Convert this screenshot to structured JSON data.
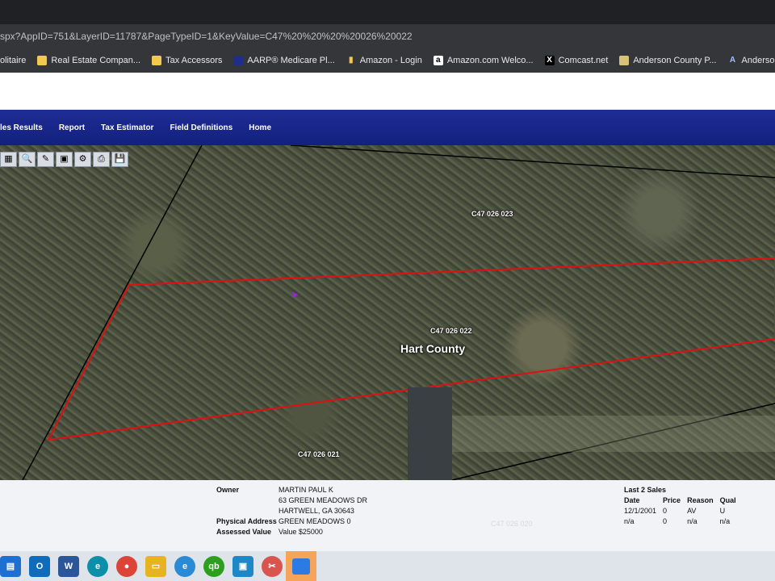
{
  "browser": {
    "url": "spx?AppID=751&LayerID=11787&PageTypeID=1&KeyValue=C47%20%20%20%20026%20022",
    "bookmarks": [
      {
        "label": "olitaire",
        "icon": "solitaire-icon"
      },
      {
        "label": "Real Estate Compan...",
        "icon": "folder-icon"
      },
      {
        "label": "Tax Accessors",
        "icon": "folder-icon"
      },
      {
        "label": "AARP® Medicare Pl...",
        "icon": "aarp-icon"
      },
      {
        "label": "Amazon - Login",
        "icon": "chart-bars-icon"
      },
      {
        "label": "Amazon.com Welco...",
        "icon": "amazon-icon"
      },
      {
        "label": "Comcast.net",
        "icon": "x-icon"
      },
      {
        "label": "Anderson County P...",
        "icon": "county-seal-icon"
      },
      {
        "label": "Anderson Cty SC Re...",
        "icon": "letter-a-icon"
      }
    ]
  },
  "nav": {
    "items": [
      "les Results",
      "Report",
      "Tax Estimator",
      "Field Definitions",
      "Home"
    ]
  },
  "toolbar": {
    "tools": [
      "layers-icon",
      "zoom-icon",
      "pencil-icon",
      "select-icon",
      "identify-icon",
      "print-icon",
      "save-icon"
    ]
  },
  "map": {
    "parcels": [
      "C47    026 023",
      "C47    026 022",
      "C47    026 021",
      "C47    026 020"
    ],
    "county_label": "Hart County"
  },
  "info": {
    "owner_label": "Owner",
    "owner_name": "MARTIN PAUL K",
    "owner_addr1": "63 GREEN MEADOWS DR",
    "owner_addr2": "HARTWELL, GA 30643",
    "physical_label": "Physical Address",
    "physical_value": "GREEN MEADOWS 0",
    "assessed_label": "Assessed Value",
    "assessed_value": "Value $25000",
    "sales_title": "Last 2 Sales",
    "sales_headers": [
      "Date",
      "Price",
      "Reason",
      "Qual"
    ],
    "sales_rows": [
      [
        "12/1/2001",
        "0",
        "AV",
        "U"
      ],
      [
        "n/a",
        "0",
        "n/a",
        "n/a"
      ]
    ]
  },
  "taskbar": {
    "apps": [
      {
        "icon": "store-icon",
        "color": "#1f6fd0"
      },
      {
        "icon": "outlook-icon",
        "color": "#0f6cbd"
      },
      {
        "icon": "word-icon",
        "color": "#2b579a"
      },
      {
        "icon": "edge-icon",
        "color": "#0c8fa8"
      },
      {
        "icon": "chrome-icon",
        "color": "#db4437"
      },
      {
        "icon": "file-explorer-icon",
        "color": "#e6b422"
      },
      {
        "icon": "internet-explorer-icon",
        "color": "#2a8ad4"
      },
      {
        "icon": "quickbooks-icon",
        "color": "#2ca01c"
      },
      {
        "icon": "remote-desktop-icon",
        "color": "#1e88c7"
      },
      {
        "icon": "snipping-tool-icon",
        "color": "#d9534f"
      },
      {
        "icon": "photos-icon",
        "color": "#2c7be5"
      }
    ]
  }
}
